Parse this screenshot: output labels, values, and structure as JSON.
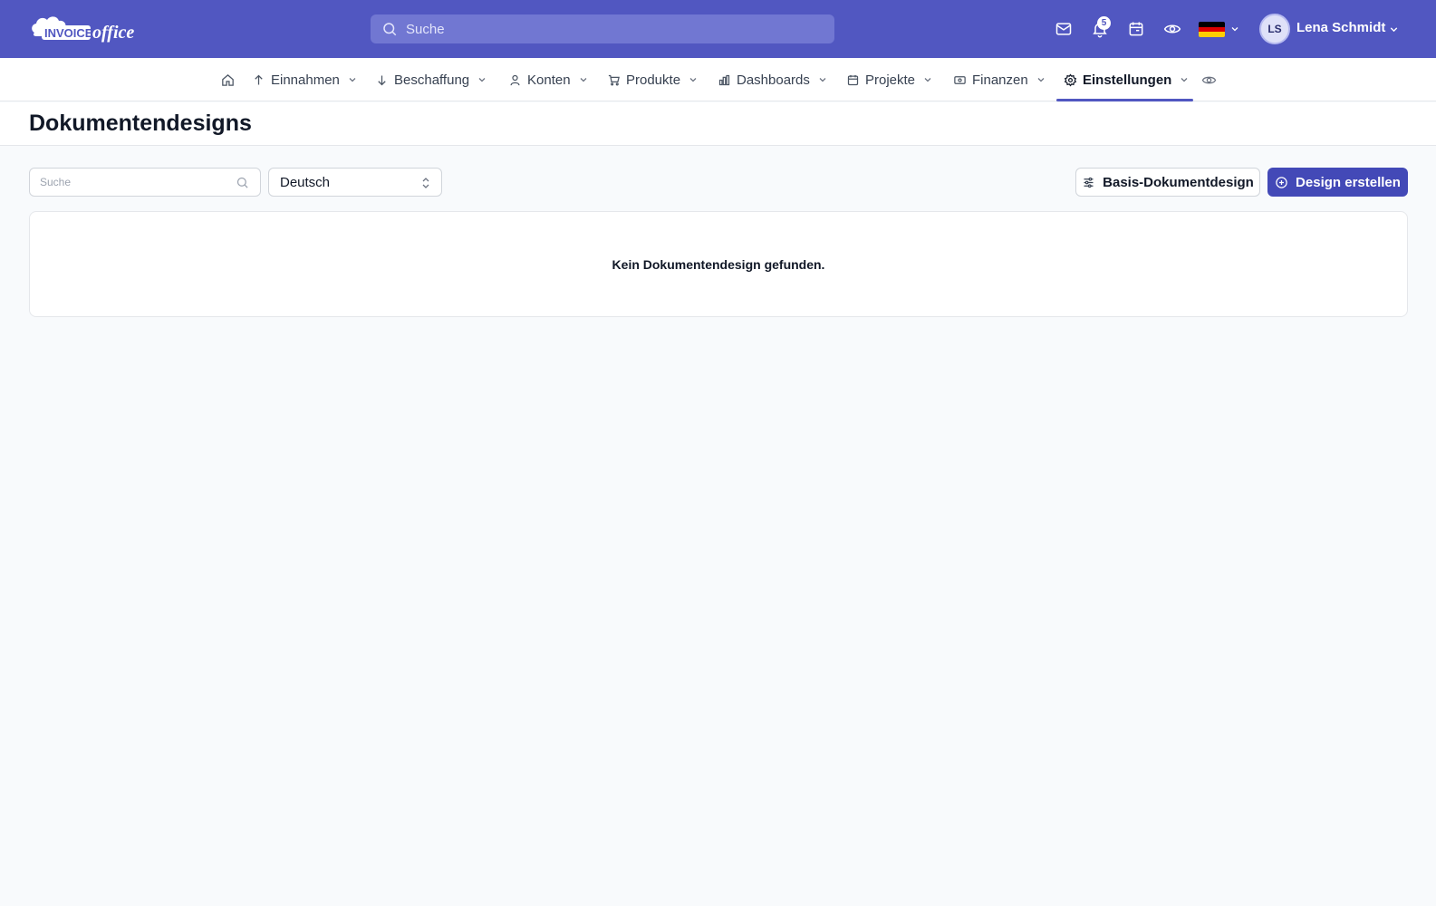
{
  "app": {
    "logo_text_1": "INVOICE",
    "logo_text_2": "office",
    "search_placeholder": "Suche",
    "notifications_count": "5",
    "language_flag": "de",
    "user": {
      "initials": "LS",
      "name": "Lena Schmidt"
    }
  },
  "nav": {
    "items": [
      {
        "label": "Einnahmen",
        "icon": "arrow-up-icon"
      },
      {
        "label": "Beschaffung",
        "icon": "arrow-down-icon"
      },
      {
        "label": "Konten",
        "icon": "user-icon"
      },
      {
        "label": "Produkte",
        "icon": "cart-icon"
      },
      {
        "label": "Dashboards",
        "icon": "bar-chart-icon"
      },
      {
        "label": "Projekte",
        "icon": "calendar-icon"
      },
      {
        "label": "Finanzen",
        "icon": "money-icon"
      },
      {
        "label": "Einstellungen",
        "icon": "gear-icon",
        "active": true
      }
    ]
  },
  "page": {
    "title": "Dokumentendesigns",
    "search_placeholder": "Suche",
    "language_select": "Deutsch",
    "basis_button": "Basis-Dokumentdesign",
    "create_button": "Design erstellen",
    "empty_message": "Kein Dokumentendesign gefunden."
  },
  "colors": {
    "brand": "#5157c1",
    "primary_button": "#4349b7",
    "background": "#f8fafc"
  }
}
